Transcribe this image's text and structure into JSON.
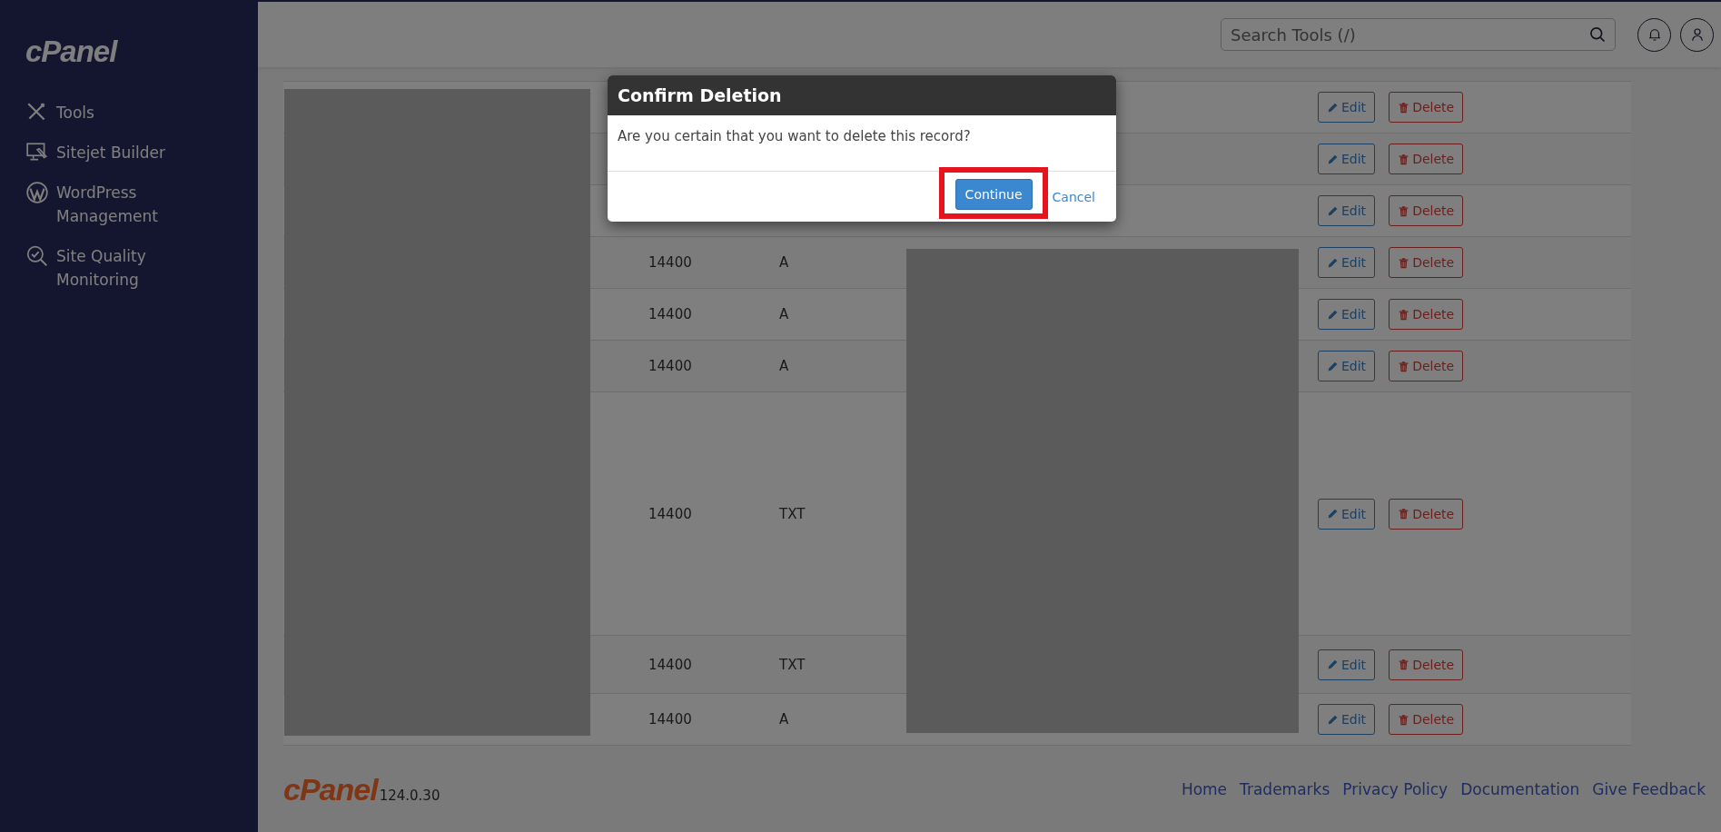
{
  "sidebar": {
    "logo": "cPanel",
    "items": [
      {
        "label": "Tools",
        "kind": "tools"
      },
      {
        "label": "Sitejet Builder",
        "kind": "builder"
      },
      {
        "label": "WordPress Management",
        "kind": "wordpress"
      },
      {
        "label": "Site Quality Monitoring",
        "kind": "monitoring"
      }
    ]
  },
  "header": {
    "search": {
      "placeholder": "Search Tools (/)"
    }
  },
  "records": {
    "rows": [
      {
        "kind": "short",
        "edit": "Edit",
        "delete": "Delete"
      },
      {
        "kind": "short",
        "edit": "Edit",
        "delete": "Delete"
      },
      {
        "kind": "short",
        "edit": "Edit",
        "delete": "Delete"
      },
      {
        "kind": "short",
        "ttl": "14400",
        "type": "A",
        "edit": "Edit",
        "delete": "Delete"
      },
      {
        "kind": "short",
        "ttl": "14400",
        "type": "A",
        "edit": "Edit",
        "delete": "Delete"
      },
      {
        "kind": "short",
        "ttl": "14400",
        "type": "A",
        "edit": "Edit",
        "delete": "Delete"
      },
      {
        "kind": "tall",
        "ttl": "14400",
        "type": "TXT",
        "edit": "Edit",
        "delete": "Delete"
      },
      {
        "kind": "medium",
        "ttl": "14400",
        "type": "TXT",
        "edit": "Edit",
        "delete": "Delete"
      },
      {
        "kind": "short",
        "ttl": "14400",
        "type": "A",
        "edit": "Edit",
        "delete": "Delete"
      }
    ]
  },
  "modal": {
    "title": "Confirm Deletion",
    "message": "Are you certain that you want to delete this record?",
    "continue": {
      "label": "Continue",
      "highlighted": true
    },
    "cancel": {
      "label": "Cancel"
    }
  },
  "footer": {
    "logo": "cPanel",
    "version": "124.0.30",
    "links": [
      "Home",
      "Trademarks",
      "Privacy Policy",
      "Documentation",
      "Give Feedback"
    ]
  }
}
